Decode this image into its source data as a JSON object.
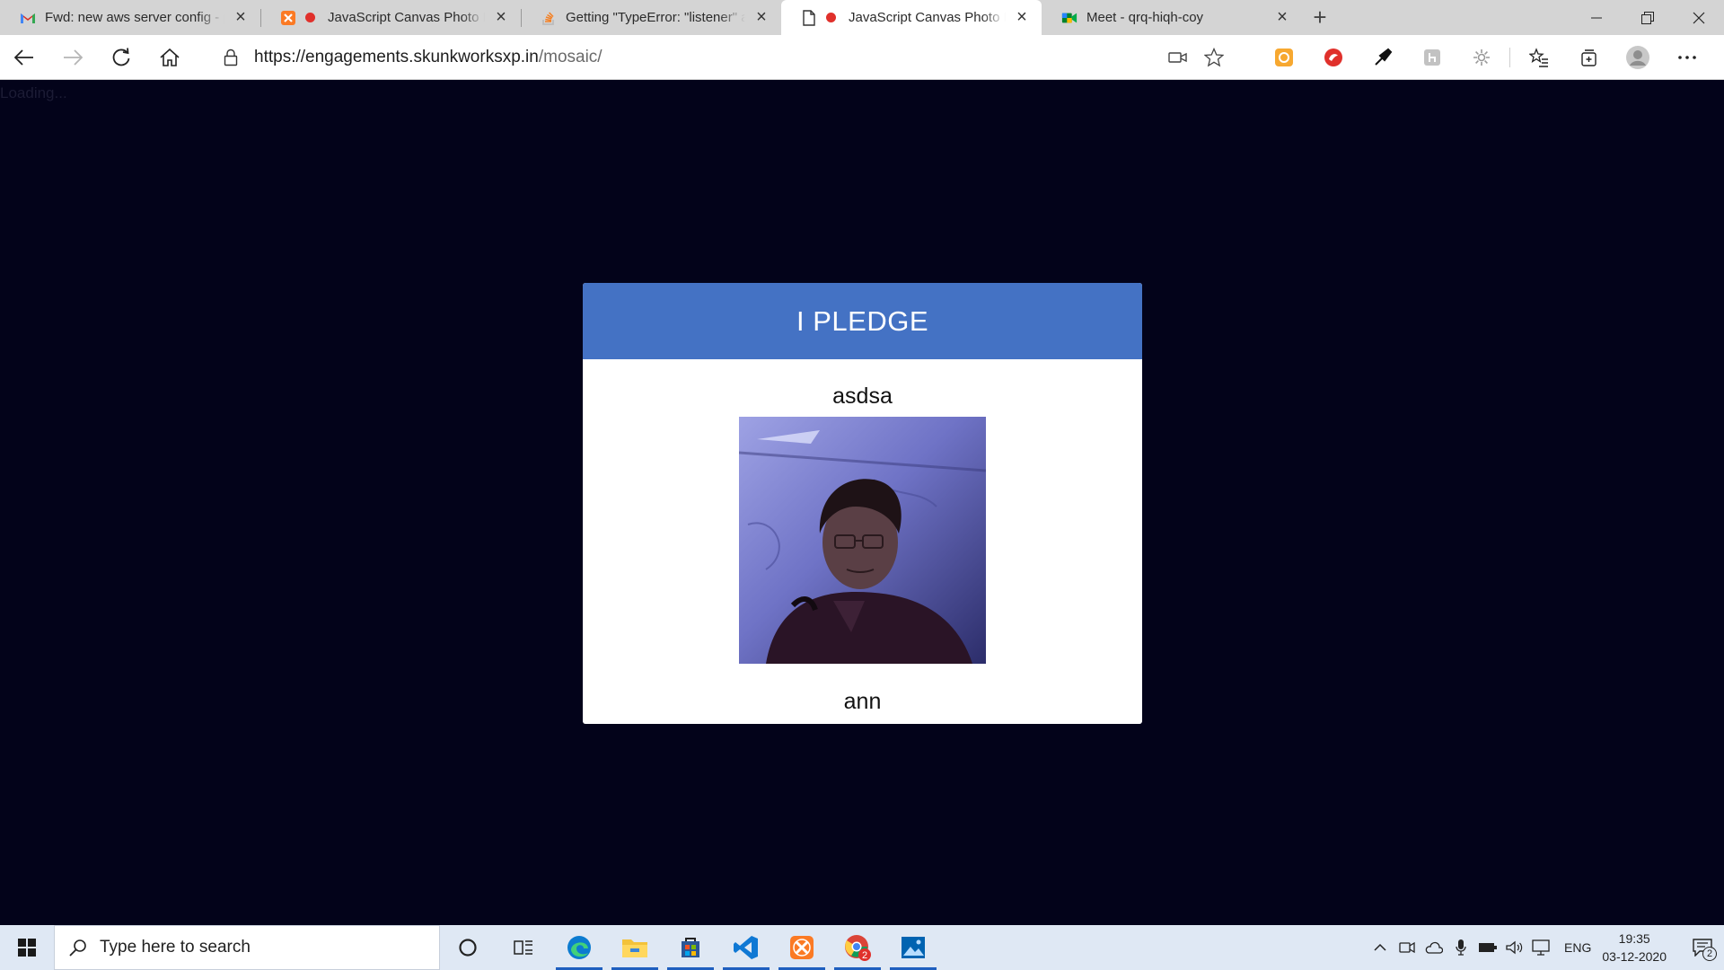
{
  "browser": {
    "tabs": [
      {
        "title": "Fwd: new aws server config - pra",
        "icon": "gmail-icon",
        "recording": false,
        "active": false
      },
      {
        "title": "JavaScript Canvas Photo Mosaic",
        "icon": "xampp-icon",
        "recording": true,
        "active": false
      },
      {
        "title": "Getting \"TypeError: \"listener\" arg",
        "icon": "stackoverflow-icon",
        "recording": false,
        "active": false
      },
      {
        "title": "JavaScript Canvas Photo Mosaic",
        "icon": "page-icon",
        "recording": true,
        "active": true
      },
      {
        "title": "Meet - qrq-hiqh-coy",
        "icon": "meet-icon",
        "recording": false,
        "active": false
      }
    ],
    "address": {
      "url_host": "https://engagements.skunkworksxp.in",
      "url_path": "/mosaic/"
    }
  },
  "page": {
    "loading_text": "Loading...",
    "card": {
      "header": "I PLEDGE",
      "name": "asdsa",
      "signature": "ann"
    }
  },
  "taskbar": {
    "search_placeholder": "Type here to search",
    "language": "ENG",
    "time": "19:35",
    "date": "03-12-2020",
    "notification_count": "2",
    "chrome_badge": "2"
  },
  "colors": {
    "page_bg": "#03031a",
    "card_header": "#4472c4",
    "recording_dot": "#e0302b"
  }
}
